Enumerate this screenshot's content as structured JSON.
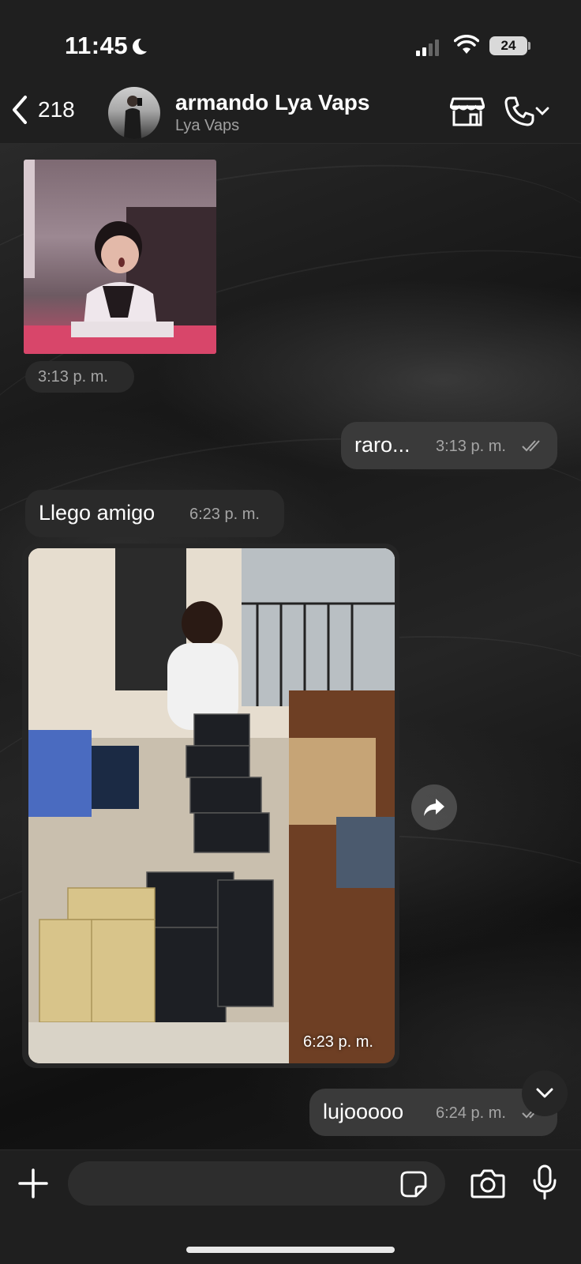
{
  "status_bar": {
    "time": "11:45",
    "battery": "24"
  },
  "header": {
    "back_count": "218",
    "contact_name": "armando Lya Vaps",
    "contact_subtitle": "Lya Vaps"
  },
  "messages": [
    {
      "direction": "in",
      "type": "gif",
      "time": "3:13 p. m."
    },
    {
      "direction": "out",
      "type": "text",
      "text": "raro...",
      "time": "3:13 p. m."
    },
    {
      "direction": "in",
      "type": "text",
      "text": "Llego amigo",
      "time": "6:23 p. m."
    },
    {
      "direction": "in",
      "type": "photo",
      "time": "6:23 p. m."
    },
    {
      "direction": "out",
      "type": "text",
      "text": "lujooooo",
      "time": "6:24 p. m."
    }
  ],
  "input": {
    "value": ""
  }
}
